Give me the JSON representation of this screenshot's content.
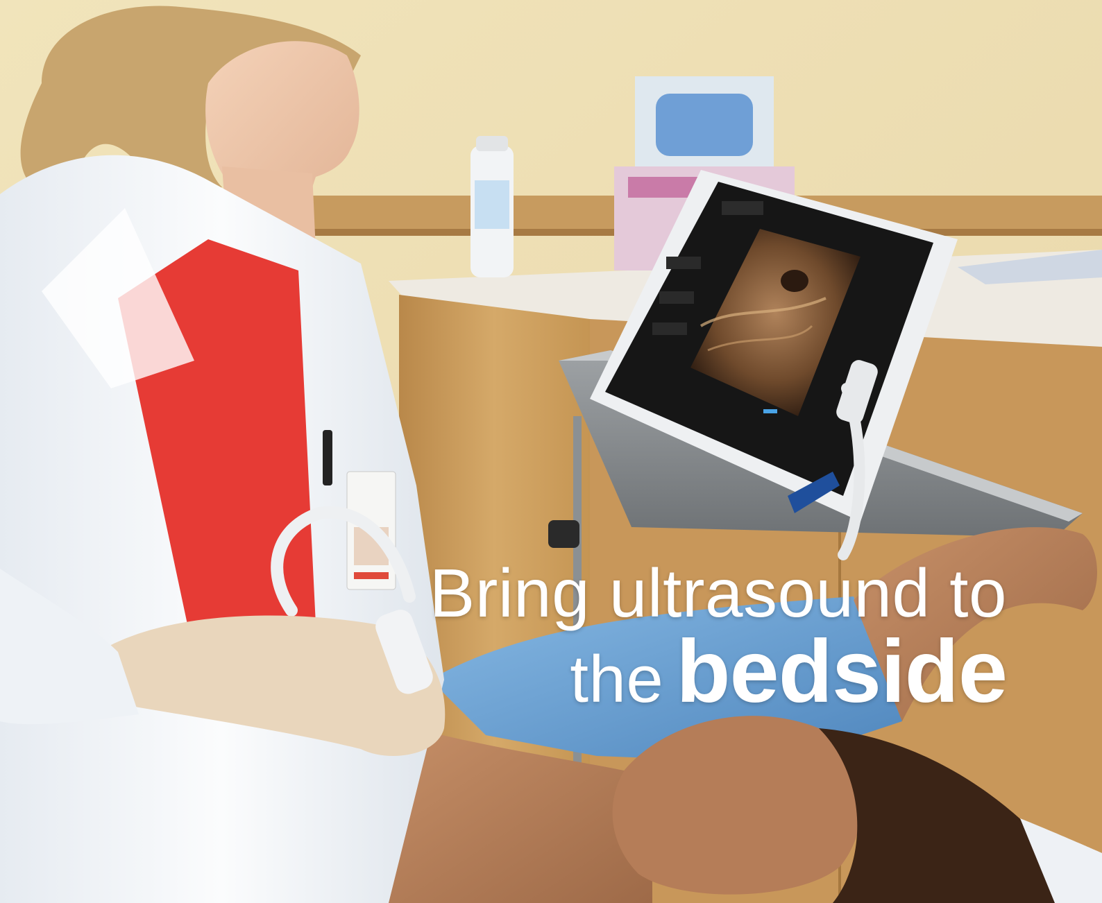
{
  "headline": {
    "line1": "Bring ultrasound to",
    "line2_prefix": "the",
    "line2_emphasis": "bedside"
  },
  "colors": {
    "wall": "#f3e6bd",
    "counter_wood": "#c89a5a",
    "lab_coat": "#f4f7fb",
    "blouse_red": "#e63b35",
    "patient_gown_blue": "#6aa3d6",
    "tablet_frame": "#eef0f2",
    "tablet_screen": "#161616",
    "headline_text": "#ffffff"
  }
}
